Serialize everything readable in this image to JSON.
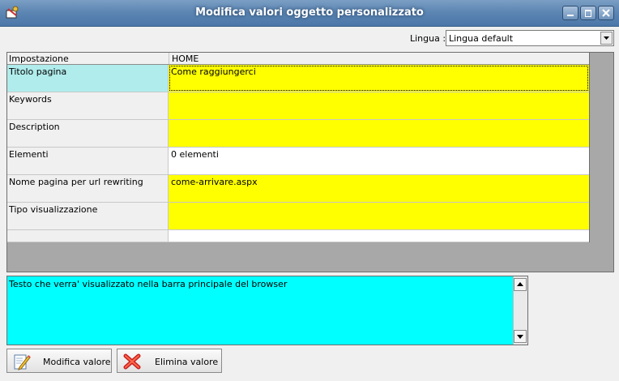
{
  "window": {
    "title": "Modifica valori oggetto personalizzato"
  },
  "language": {
    "label": "Lingua :",
    "value": "Lingua default"
  },
  "grid": {
    "headers": [
      "Impostazione",
      "HOME"
    ],
    "rows": [
      {
        "name": "Titolo pagina",
        "value": "Come raggiungerci",
        "fill": "#ffff00"
      },
      {
        "name": "Keywords",
        "value": "",
        "fill": "#ffff00"
      },
      {
        "name": "Description",
        "value": "",
        "fill": "#ffff00"
      },
      {
        "name": "Elementi",
        "value": "0 elementi",
        "fill": "#ffffff"
      },
      {
        "name": "Nome pagina per url rewriting",
        "value": "come-arrivare.aspx",
        "fill": "#ffff00"
      },
      {
        "name": "Tipo visualizzazione",
        "value": "",
        "fill": "#ffff00"
      },
      {
        "name": "",
        "value": "",
        "fill": "#ffffff"
      }
    ]
  },
  "description": {
    "text": "Testo che verra' visualizzato nella barra principale del browser"
  },
  "buttons": {
    "edit": "Modifica valore",
    "delete": "Elimina valore"
  },
  "colors": {
    "highlight": "#ffff00",
    "description_bg": "#00ffff",
    "selected_label": "#b0ecec"
  }
}
